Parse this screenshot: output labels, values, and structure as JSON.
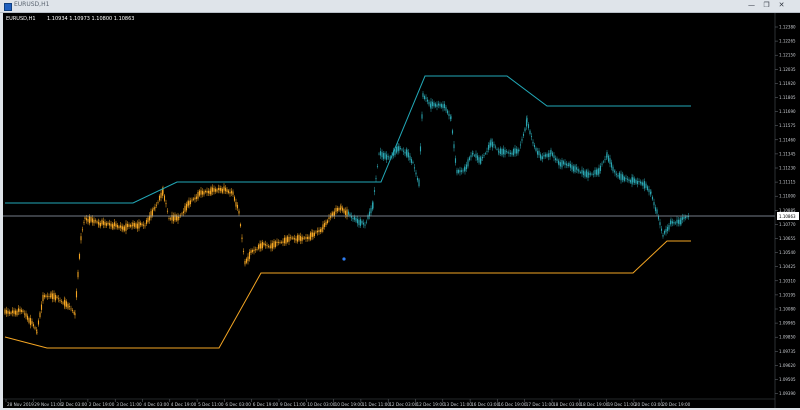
{
  "window": {
    "title": "EURUSD,H1",
    "buttons": [
      "—",
      "❐",
      "✕"
    ]
  },
  "chart": {
    "symbol": "EURUSD,H1",
    "ohlc": "1.10934 1.10973 1.10800 1.10863",
    "current_price": "1.10863",
    "price_axis": [
      "1.12380",
      "1.12265",
      "1.12150",
      "1.12035",
      "1.11920",
      "1.11805",
      "1.11690",
      "1.11575",
      "1.11460",
      "1.11345",
      "1.11230",
      "1.11115",
      "1.11000",
      "1.10885",
      "1.10770",
      "1.10655",
      "1.10540",
      "1.10425",
      "1.10310",
      "1.10195",
      "1.10080",
      "1.09965",
      "1.09850",
      "1.09735",
      "1.09620",
      "1.09505",
      "1.09390"
    ],
    "date_axis": [
      "28 Nov 2019",
      "29 Nov 11:00",
      "2 Dec 03:00",
      "2 Dec 19:00",
      "3 Dec 11:00",
      "4 Dec 03:00",
      "4 Dec 19:00",
      "5 Dec 11:00",
      "6 Dec 03:00",
      "6 Dec 19:00",
      "9 Dec 11:00",
      "10 Dec 03:00",
      "10 Dec 19:00",
      "11 Dec 11:00",
      "12 Dec 03:00",
      "12 Dec 19:00",
      "13 Dec 11:00",
      "16 Dec 03:00",
      "16 Dec 19:00",
      "17 Dec 11:00",
      "18 Dec 03:00",
      "18 Dec 19:00",
      "19 Dec 11:00",
      "20 Dec 03:00",
      "20 Dec 19:00"
    ],
    "colors": {
      "background": "#000000",
      "candles_first_part": "#f5a623",
      "candles_second_part": "#2aa5b0",
      "upper_band": "#22a9b8",
      "lower_band": "#f5a623",
      "price_line": "#9aa7b5",
      "marker_dot": "#2f7df0"
    }
  }
}
